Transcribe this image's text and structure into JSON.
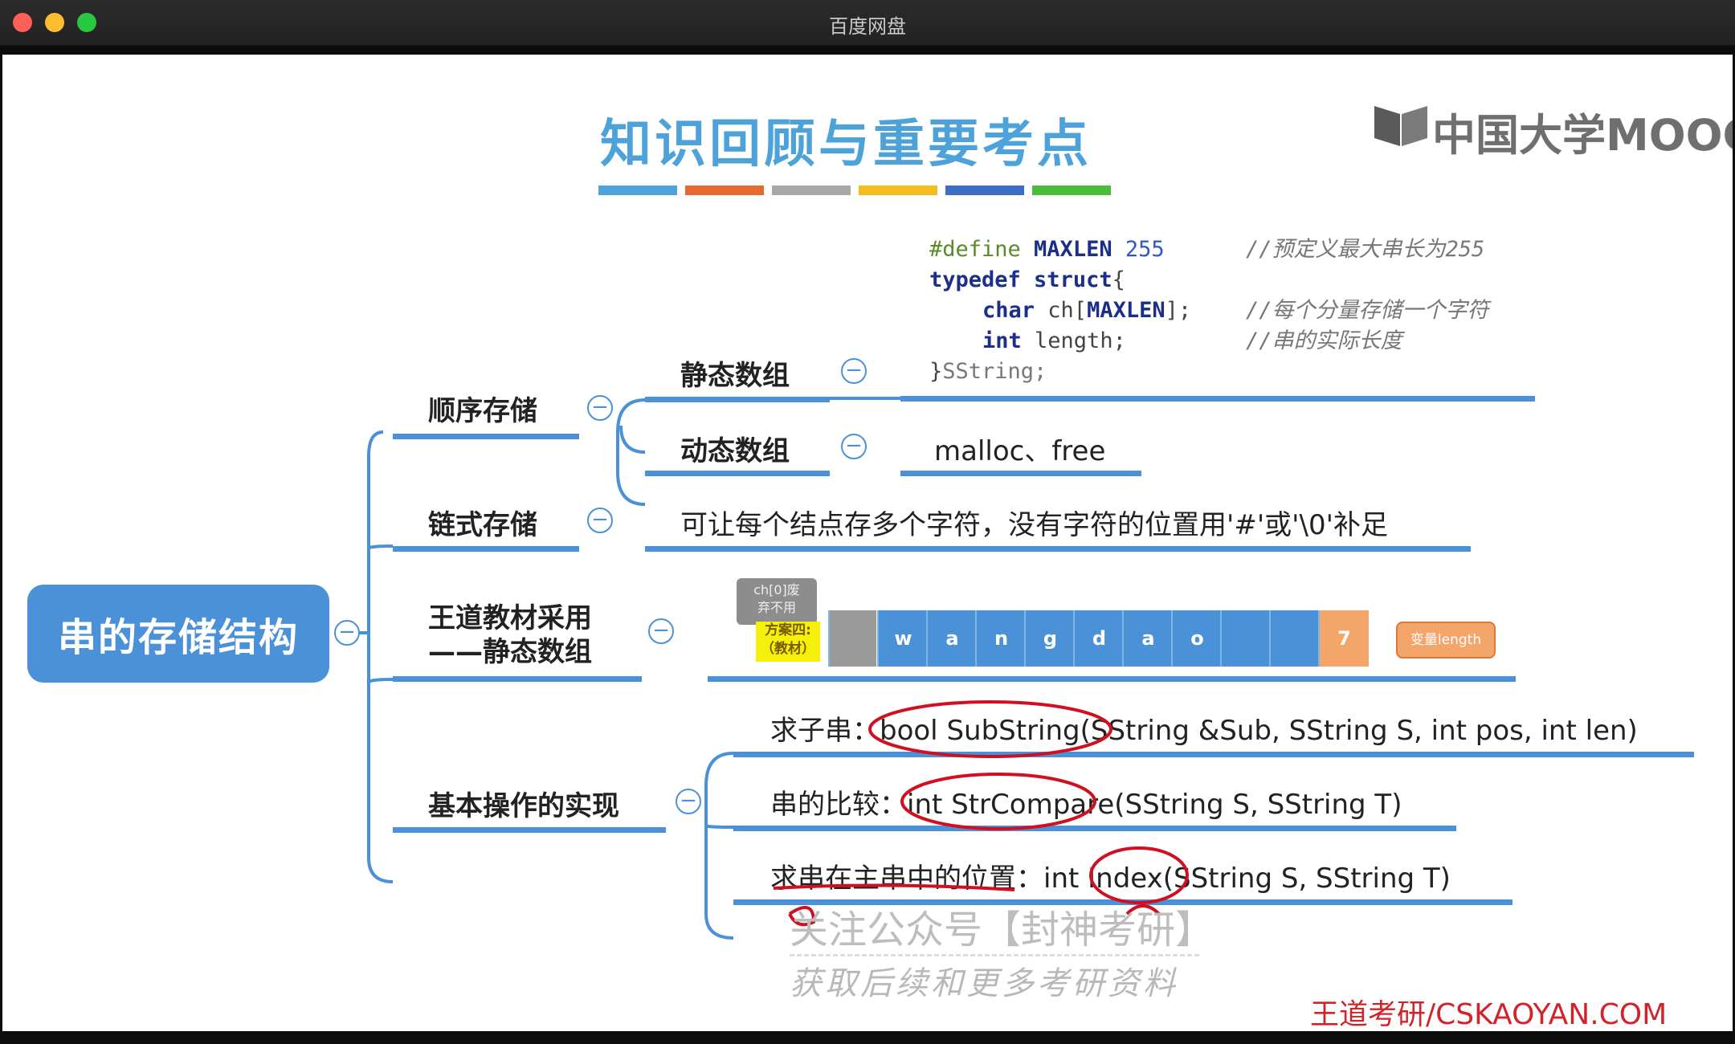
{
  "window": {
    "title": "百度网盘"
  },
  "slide": {
    "title": "知识回顾与重要考点",
    "color_bars": [
      "#4da3d9",
      "#e8692f",
      "#a8a8a8",
      "#f3bd1b",
      "#3c6ec6",
      "#4cba3a"
    ],
    "logo_text": "中国大学MOOC",
    "root_label": "串的存储结构",
    "branches": {
      "sequential": "顺序存储",
      "static_array": "静态数组",
      "dynamic_array": "动态数组",
      "dynamic_desc": "malloc、free",
      "linked": "链式存储",
      "linked_desc": "可让每个结点存多个字符，没有字符的位置用'#'或'\\0'补足",
      "wangdao_line1": "王道教材采用",
      "wangdao_line2": "——静态数组",
      "basic_ops": "基本操作的实现"
    },
    "code": {
      "l1_a": "#define ",
      "l1_b": "MAXLEN",
      "l1_c": " 255",
      "l1_comment": "//预定义最大串长为255",
      "l2_a": "typedef",
      "l2_b": " struct",
      "l2_c": "{",
      "l3_a": "char",
      "l3_b": " ch[",
      "l3_c": "MAXLEN",
      "l3_d": "];",
      "l3_comment": "//每个分量存储一个字符",
      "l4_a": "int",
      "l4_b": " length;",
      "l4_comment": "//串的实际长度",
      "l5_a": "}",
      "l5_b": "SString;"
    },
    "array_diagram": {
      "note_gray": "ch[0]废\n弃不用",
      "note_yellow": "方案四:\n（教材）",
      "cells": [
        "",
        "w",
        "a",
        "n",
        "g",
        "d",
        "a",
        "o",
        "",
        "",
        "7"
      ],
      "note_orange": "变量length",
      "colors": {
        "unused": "#9a9a9a",
        "char": "#4b91d8",
        "length": "#f4a56a"
      }
    },
    "operations": [
      {
        "label": "求子串：",
        "signature": "bool SubString(SString &Sub, SString S, int pos, int len)"
      },
      {
        "label": "串的比较：",
        "signature": "int StrCompare(SString S, SString T)"
      },
      {
        "label": "求串在主串中的位置：",
        "signature": "int Index(SString S, SString T)"
      }
    ],
    "watermark": {
      "line1": "关注公众号【封神考研】",
      "line2": "获取后续和更多考研资料"
    },
    "brand": "王道考研/CSKAOYAN.COM"
  }
}
